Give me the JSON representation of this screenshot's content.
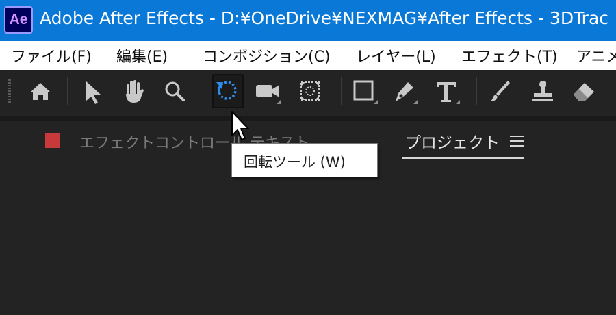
{
  "titlebar": {
    "app_icon": "Ae",
    "title": "Adobe After Effects - D:¥OneDrive¥NEXMAG¥After Effects - 3DTrac",
    "color": "#0A78D6"
  },
  "menubar": {
    "items": [
      "ファイル(F)",
      "編集(E)",
      "コンポジション(C)",
      "レイヤー(L)",
      "エフェクト(T)",
      "アニメ"
    ]
  },
  "toolbar": {
    "tools": [
      "home-icon",
      "selection-tool-icon",
      "hand-tool-icon",
      "zoom-tool-icon",
      "rotate-tool-icon",
      "camera-tool-icon",
      "pan-behind-tool-icon",
      "rectangle-tool-icon",
      "pen-tool-icon",
      "type-tool-icon",
      "brush-tool-icon",
      "clone-stamp-tool-icon",
      "eraser-tool-icon"
    ],
    "active_tool": "rotate-tool-icon"
  },
  "panels": {
    "effect_controls_tab": "エフェクトコントロール テキスト",
    "project_tab": "プロジェクト",
    "swatch_color": "#C8393B"
  },
  "tooltip": {
    "text": "回転ツール (W)"
  }
}
